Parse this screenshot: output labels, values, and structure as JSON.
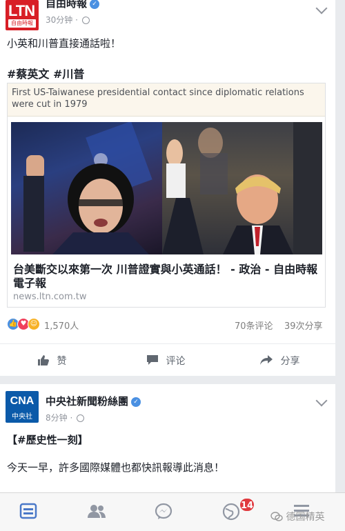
{
  "post1": {
    "page_name": "自由時報",
    "logo_big": "LTN",
    "logo_small": "自由時報",
    "time": "30分钟 ·",
    "message": "小英和川普直接通話啦！",
    "hashtags": "#蔡英文 #川普",
    "card": {
      "caption": "First US-Taiwanese presidential contact since diplomatic relations were cut in 1979",
      "headline": "台美斷交以來第一次 川普證實與小英通話！ - 政治 - 自由時報電子報",
      "domain": "news.ltn.com.tw"
    },
    "reactions_count": "1,570人",
    "comments": "70条评论",
    "shares": "39次分享",
    "actions": {
      "like": "赞",
      "comment": "评论",
      "share": "分享"
    }
  },
  "post2": {
    "page_name": "中央社新聞粉絲團",
    "logo_top": "CNA",
    "logo_bottom": "中央社",
    "time": "8分钟 ·",
    "hashtag": "【#歷史性一刻】",
    "message": "今天一早，許多國際媒體也都快訊報導此消息！"
  },
  "tabbar": {
    "notifications_badge": "14"
  },
  "watermark": "德国精英",
  "colors": {
    "accent": "#4a90e2",
    "brand_red": "#d81e26",
    "cna_blue": "#0b5aa9",
    "badge": "#e0393e"
  }
}
